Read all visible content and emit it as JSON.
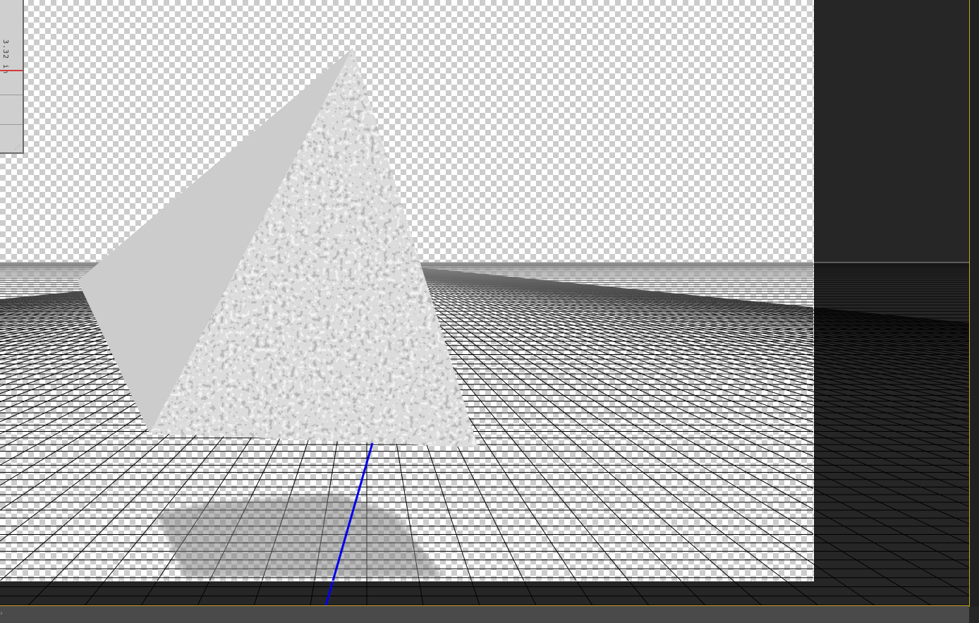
{
  "document": {
    "dimension_readout": "3.32 in"
  },
  "viewport": {
    "ground_plane": "grid",
    "object": "pyramid",
    "texture": "noise",
    "axis_color": "#0000ee"
  },
  "colors": {
    "workspace": "#262626",
    "grid_line": "#000000",
    "pyramid_light_face": "#cccccc",
    "shadow": "#8a8a8a",
    "frame_accent": "#c9a227"
  },
  "bottom_bar": {
    "expand_icon": "chevron-right-icon"
  }
}
